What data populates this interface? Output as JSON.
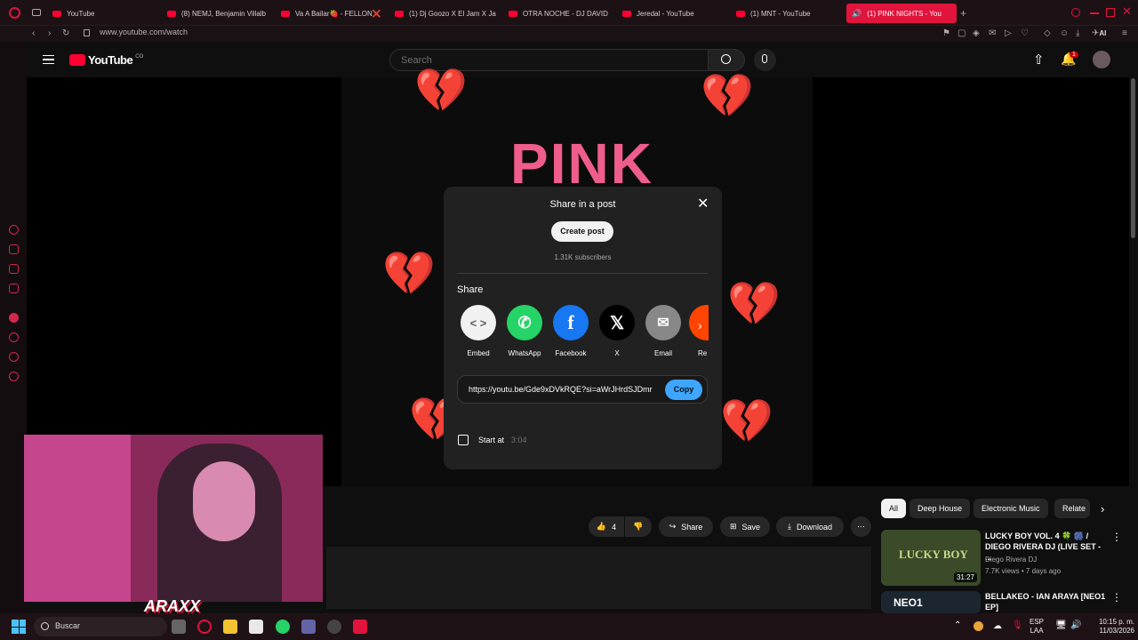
{
  "browser": {
    "tabs": [
      {
        "label": "YouTube"
      },
      {
        "label": "(8) NEMJ, Benjamin Villalb"
      },
      {
        "label": "Va A Bailar🍓 - FELLON❌"
      },
      {
        "label": "(1) Dj Goozo X El Jam X Ja"
      },
      {
        "label": "OTRA NOCHE - DJ DAVID"
      },
      {
        "label": "Jeredal - YouTube"
      },
      {
        "label": "(1) MNT - YouTube"
      },
      {
        "label": "(1) PINK NIGHTS - You"
      }
    ],
    "url": "www.youtube.com/watch",
    "ai_label": "AI"
  },
  "youtube": {
    "logo": "YouTube",
    "region": "CO",
    "search_placeholder": "Search",
    "notification_count": "1"
  },
  "video": {
    "art_title": "PINK"
  },
  "modal": {
    "title": "Share in a post",
    "create_post": "Create post",
    "subscribers": "1.31K subscribers",
    "share_heading": "Share",
    "share_targets": [
      {
        "label": "Embed",
        "icon": "embed-icon",
        "color": "#f1f1f1"
      },
      {
        "label": "WhatsApp",
        "icon": "whatsapp-icon",
        "color": "#25d366"
      },
      {
        "label": "Facebook",
        "icon": "facebook-icon",
        "color": "#1877f2"
      },
      {
        "label": "X",
        "icon": "x-icon",
        "color": "#000000"
      },
      {
        "label": "Email",
        "icon": "email-icon",
        "color": "#888888"
      },
      {
        "label": "Re",
        "icon": "reddit-icon",
        "color": "#ff4500"
      }
    ],
    "link": "https://youtu.be/Gde9xDVkRQE?si=aWrJHrdSJDmr",
    "copy": "Copy",
    "start_at_label": "Start at",
    "start_at_value": "3:04"
  },
  "actions": {
    "likes": "4",
    "share": "Share",
    "save": "Save",
    "download": "Download"
  },
  "chips": [
    "All",
    "Deep House",
    "Electronic Music",
    "Relate"
  ],
  "related": [
    {
      "title": "LUCKY BOY VOL. 4 🍀 🎆 / DIEGO RIVERA DJ (LIVE SET - ...",
      "channel": "Diego Rivera DJ",
      "meta": "7.7K views • 7 days ago",
      "duration": "31:27",
      "thumb_text": "LUCKY BOY"
    },
    {
      "title": "BELLAKEO - IAN ARAYA [NEO1 EP]",
      "thumb_text": "NEO1"
    }
  ],
  "overlay": {
    "logo_text": "ARAXX"
  },
  "taskbar": {
    "search": "Buscar",
    "lang_top": "ESP",
    "lang_bottom": "LAA",
    "time": "10:15 p. m.",
    "date": "11/03/2026"
  },
  "colors": {
    "accent": "#e0143c",
    "copy_blue": "#3ea6ff",
    "art_pink": "#ee5d8c"
  }
}
